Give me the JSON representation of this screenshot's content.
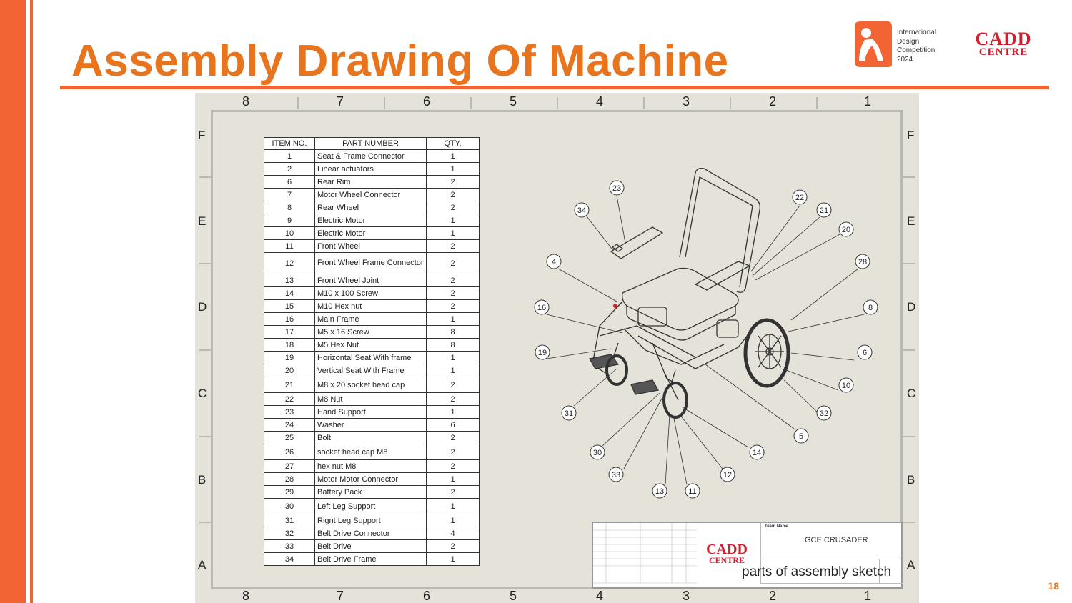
{
  "slide": {
    "title": "Assembly Drawing Of Machine",
    "page_number": "18",
    "idc_logo_text": [
      "International",
      "Design",
      "Competition",
      "2024"
    ],
    "cadd_logo": [
      "CADD",
      "CENTRE"
    ]
  },
  "sheet": {
    "zones_columns": [
      "8",
      "7",
      "6",
      "5",
      "4",
      "3",
      "2",
      "1"
    ],
    "zones_rows": [
      "F",
      "E",
      "D",
      "C",
      "B",
      "A"
    ],
    "bom_headers": [
      "ITEM NO.",
      "PART NUMBER",
      "QTY."
    ],
    "bom_rows": [
      {
        "item": "1",
        "part": "Seat & Frame Connector",
        "qty": "1"
      },
      {
        "item": "2",
        "part": "Linear actuators",
        "qty": "1"
      },
      {
        "item": "6",
        "part": "Rear Rim",
        "qty": "2"
      },
      {
        "item": "7",
        "part": "Motor Wheel Connector",
        "qty": "2"
      },
      {
        "item": "8",
        "part": "Rear Wheel",
        "qty": "2"
      },
      {
        "item": "9",
        "part": "Electric Motor",
        "qty": "1"
      },
      {
        "item": "10",
        "part": "Electric Motor",
        "qty": "1"
      },
      {
        "item": "11",
        "part": "Front Wheel",
        "qty": "2"
      },
      {
        "item": "12",
        "part": "Front Wheel Frame Connector",
        "qty": "2"
      },
      {
        "item": "13",
        "part": "Front Wheel Joint",
        "qty": "2"
      },
      {
        "item": "14",
        "part": "M10 x 100 Screw",
        "qty": "2"
      },
      {
        "item": "15",
        "part": "M10 Hex nut",
        "qty": "2"
      },
      {
        "item": "16",
        "part": "Main Frame",
        "qty": "1"
      },
      {
        "item": "17",
        "part": "M5 x 16 Screw",
        "qty": "8"
      },
      {
        "item": "18",
        "part": "M5 Hex Nut",
        "qty": "8"
      },
      {
        "item": "19",
        "part": "Horizontal Seat With frame",
        "qty": "1"
      },
      {
        "item": "20",
        "part": "Vertical Seat With Frame",
        "qty": "1"
      },
      {
        "item": "21",
        "part": "M8 x 20 socket head cap",
        "qty": "2"
      },
      {
        "item": "22",
        "part": "M8 Nut",
        "qty": "2"
      },
      {
        "item": "23",
        "part": "Hand Support",
        "qty": "1"
      },
      {
        "item": "24",
        "part": "Washer",
        "qty": "6"
      },
      {
        "item": "25",
        "part": "Bolt",
        "qty": "2"
      },
      {
        "item": "26",
        "part": "socket head cap  M8",
        "qty": "2"
      },
      {
        "item": "27",
        "part": "hex nut  M8",
        "qty": "2"
      },
      {
        "item": "28",
        "part": "Motor Motor Connector",
        "qty": "1"
      },
      {
        "item": "29",
        "part": "Battery Pack",
        "qty": "2"
      },
      {
        "item": "30",
        "part": "Left Leg Support",
        "qty": "1"
      },
      {
        "item": "31",
        "part": "Rignt Leg Support",
        "qty": "1"
      },
      {
        "item": "32",
        "part": "Belt Drive Connector",
        "qty": "4"
      },
      {
        "item": "33",
        "part": "Belt Drive",
        "qty": "2"
      },
      {
        "item": "34",
        "part": "Belt Drive Frame",
        "qty": "1"
      }
    ],
    "balloons": [
      "23",
      "34",
      "22",
      "21",
      "20",
      "4",
      "28",
      "16",
      "8",
      "19",
      "6",
      "10",
      "31",
      "32",
      "5",
      "30",
      "14",
      "33",
      "12",
      "13",
      "11"
    ],
    "title_block": {
      "team_label": "Team Name",
      "team_name": "GCE CRUSADER",
      "sketch_caption": "parts of assembly sketch",
      "cadd_logo": [
        "CADD",
        "CENTRE"
      ]
    }
  }
}
